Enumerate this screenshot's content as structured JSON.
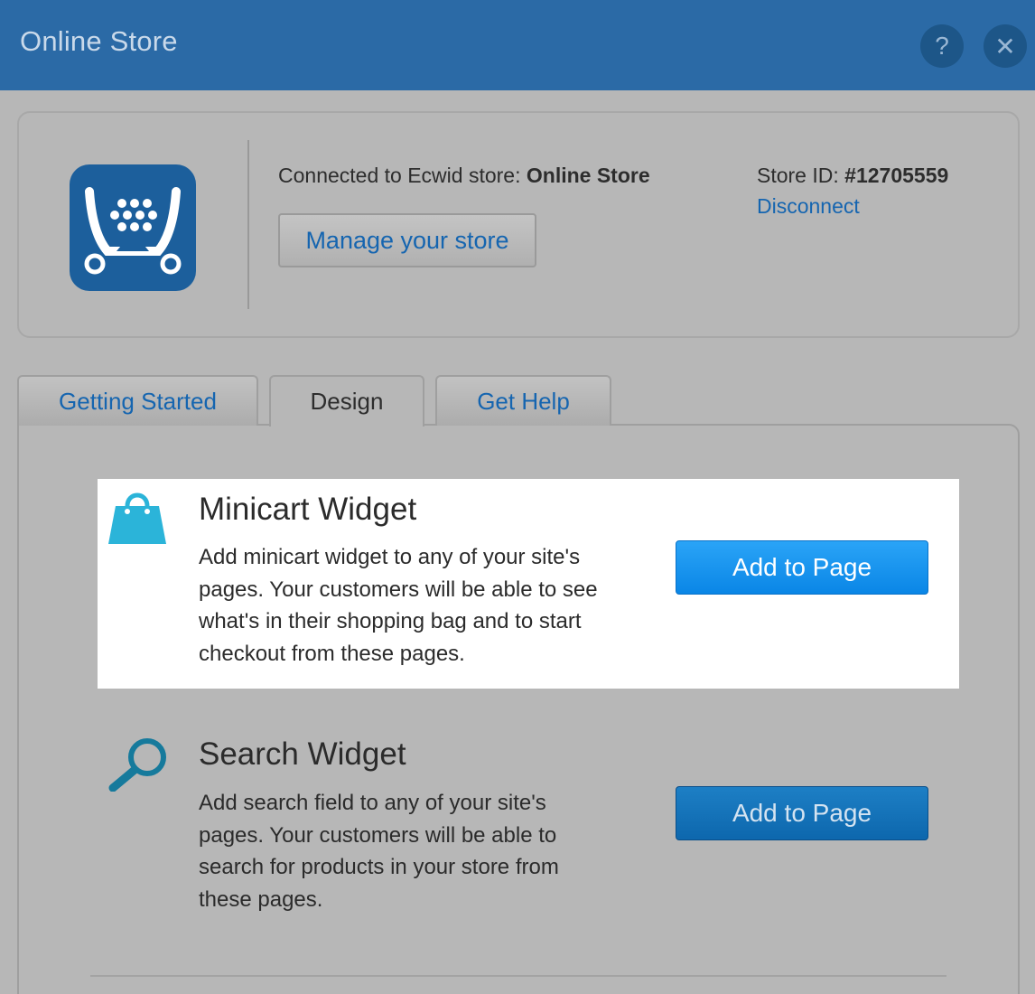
{
  "header": {
    "title": "Online Store",
    "help_label": "?",
    "close_label": "✕"
  },
  "store": {
    "connected_prefix": "Connected to Ecwid store: ",
    "store_name": "Online Store",
    "manage_label": "Manage your store",
    "store_id_prefix": "Store ID: ",
    "store_id": "#12705559",
    "disconnect_label": "Disconnect",
    "logo_icon": "ecwid-cart-icon"
  },
  "tabs": [
    {
      "label": "Getting Started",
      "active": false
    },
    {
      "label": "Design",
      "active": true
    },
    {
      "label": "Get Help",
      "active": false
    }
  ],
  "widgets": [
    {
      "icon": "shopping-bag-icon",
      "title": "Minicart Widget",
      "lines": [
        "Add minicart widget to any of your site's",
        "pages. Your customers will be able to see",
        "what's in their shopping bag and to start",
        "checkout from these pages."
      ],
      "button_label": "Add to Page",
      "highlighted": true
    },
    {
      "icon": "magnifier-icon",
      "title": "Search Widget",
      "lines": [
        "Add search field to any of your site's",
        "pages. Your customers will be able to",
        "search for products in your store from",
        "these pages."
      ],
      "button_label": "Add to Page",
      "highlighted": false
    }
  ],
  "colors": {
    "header_bg": "#2b6aa6",
    "overlay_bg": "#b7b7b7",
    "link_blue": "#1565b0",
    "bag_cyan": "#2bb4d9",
    "logo_blue": "#1c5f9c"
  }
}
